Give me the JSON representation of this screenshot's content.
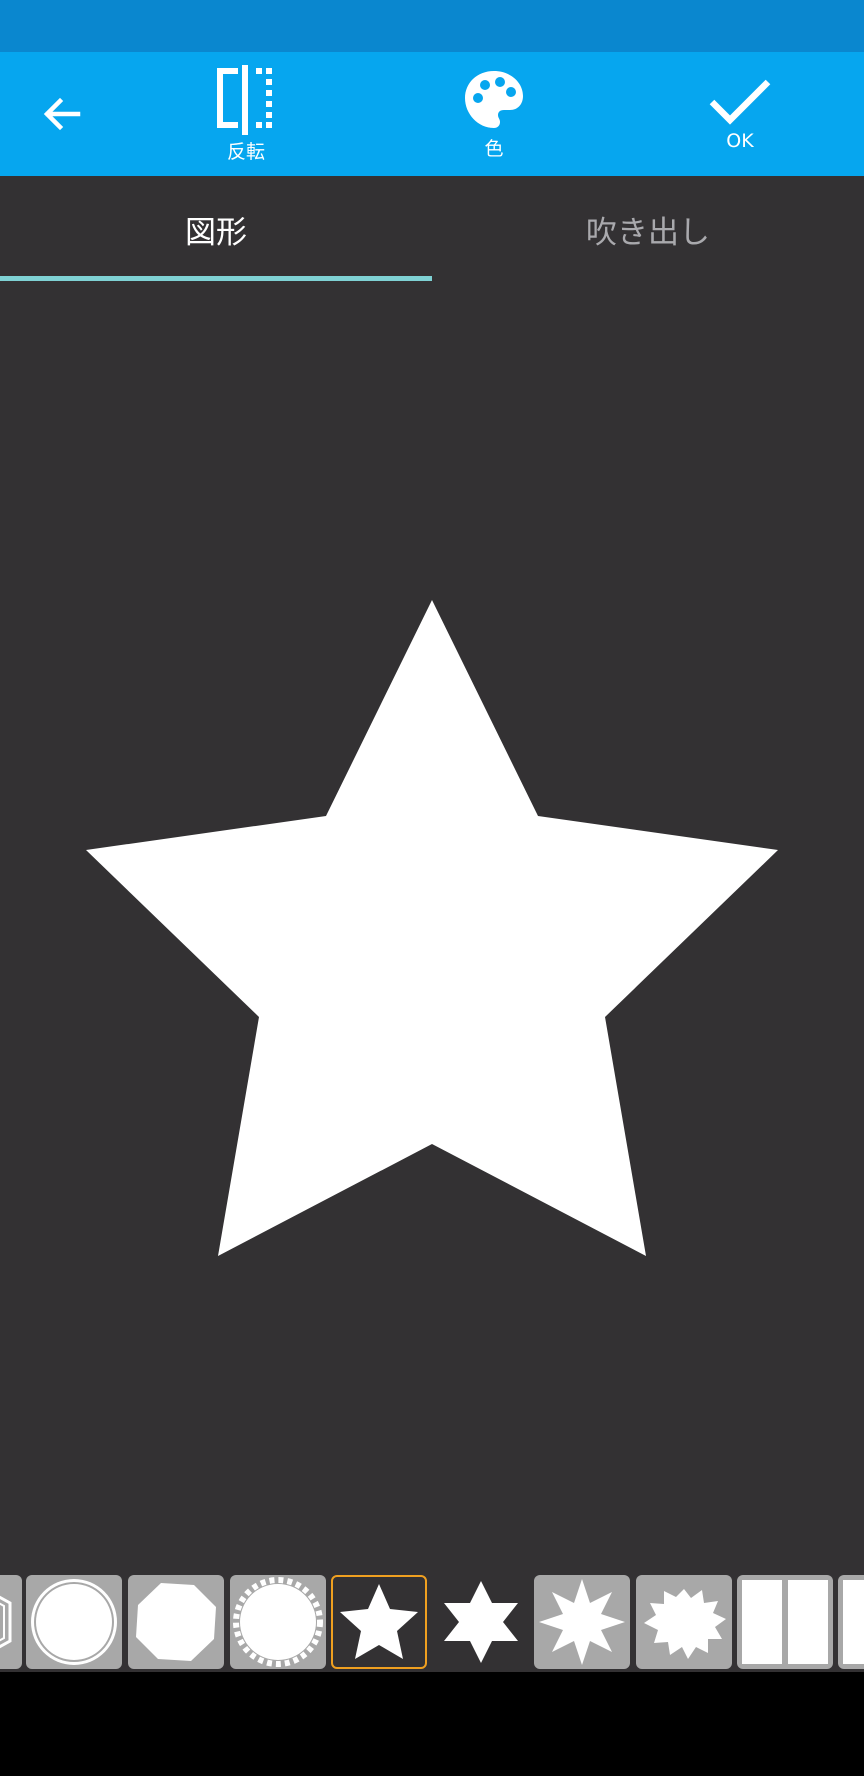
{
  "colors": {
    "status_bar": "#0a87cf",
    "toolbar": "#06a6ef",
    "background": "#333133",
    "tab_indicator": "#7fd1d4",
    "selected_border": "#f0a020",
    "thumb_bg": "#a8a8a8"
  },
  "toolbar": {
    "back_icon": "arrow-left-icon",
    "flip_label": "反転",
    "color_label": "色",
    "ok_label": "OK"
  },
  "tabs": [
    {
      "label": "図形",
      "selected": true
    },
    {
      "label": "吹き出し",
      "selected": false
    }
  ],
  "canvas": {
    "shape": "star-5-point",
    "shape_color": "#ffffff"
  },
  "shape_strip": {
    "items": [
      {
        "name": "hexagon-outline",
        "selected": false
      },
      {
        "name": "circle-outline",
        "selected": false
      },
      {
        "name": "octagon",
        "selected": false
      },
      {
        "name": "scalloped-circle",
        "selected": false
      },
      {
        "name": "star-5-point",
        "selected": true
      },
      {
        "name": "star-6-point",
        "selected": false
      },
      {
        "name": "star-8-point",
        "selected": false
      },
      {
        "name": "burst",
        "selected": false
      },
      {
        "name": "two-column-rectangle",
        "selected": false
      },
      {
        "name": "rectangle",
        "selected": false
      }
    ]
  }
}
